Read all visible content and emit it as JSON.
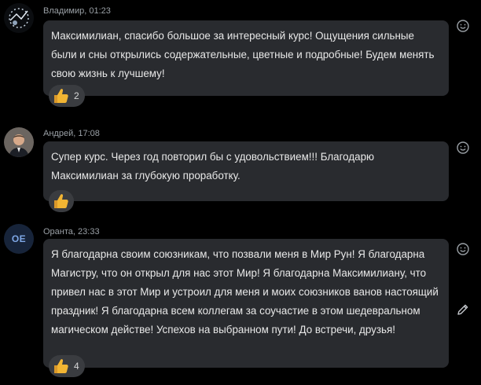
{
  "messages": [
    {
      "author": "Владимир",
      "time": "01:23",
      "text": "Максимилиан, спасибо большое за интересный курс! Ощущения сильные были и сны открылись содержательные, цветные и подробные! Будем менять свою жизнь к лучшему!",
      "reaction": {
        "icon": "thumbs-up-icon",
        "count": "2"
      }
    },
    {
      "author": "Андрей",
      "time": "17:08",
      "text": "Супер курс. Через год повторил бы с удовольствием!!! Благодарю Максимилиан за глубокую проработку.",
      "reaction": {
        "icon": "thumbs-up-icon",
        "count": ""
      }
    },
    {
      "author": "Оранта",
      "time": "23:33",
      "avatar_initials": "OE",
      "text": "Я благодарна своим союзникам, что позвали меня в Мир Рун! Я благодарна Магистру, что он открыл для нас этот Мир! Я благодарна Максимилиану, что привел нас в этот Мир и устроил для меня и моих союзников ванов настоящий праздник! Я благодарна всем коллегам  за соучастие в этом шедевральном магическом действе! Успехов на выбранном пути! До встречи, друзья!",
      "reaction": {
        "icon": "thumbs-up-icon",
        "count": "4"
      }
    }
  ],
  "meta_separator": ", ",
  "colors": {
    "background": "#000000",
    "bubble": "#292b2f",
    "reaction_pill": "#3a3c40",
    "text": "#e8e8e8",
    "meta": "#9aa0a6",
    "initials_avatar_bg": "#17243a",
    "initials_avatar_fg": "#7ea7e6",
    "thumb": "#f2b533"
  }
}
